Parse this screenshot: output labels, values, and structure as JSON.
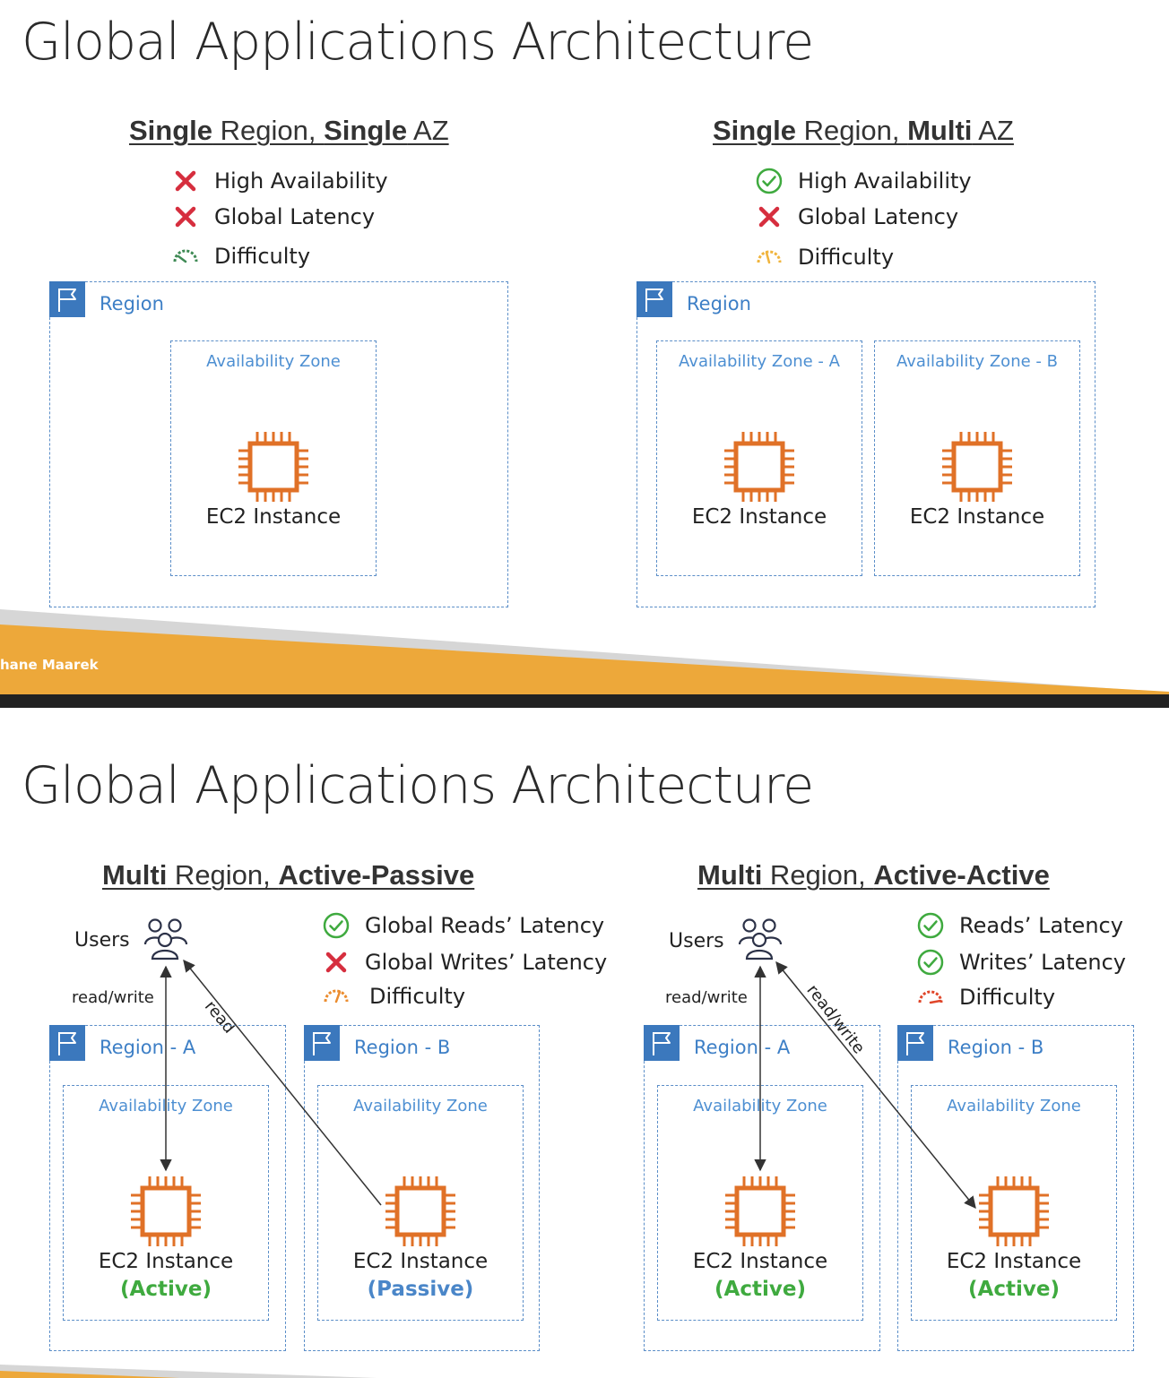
{
  "slide1": {
    "title": "Global Applications Architecture",
    "footer_author": "hane Maarek",
    "left": {
      "heading": {
        "b1": "Single",
        "t1": " Region, ",
        "b2": "Single",
        "t2": " AZ"
      },
      "criteria": [
        {
          "icon": "cross-icon",
          "label": "High Availability"
        },
        {
          "icon": "cross-icon",
          "label": "Global Latency"
        },
        {
          "icon": "difficulty-gauge-low-icon",
          "label": "Difficulty"
        }
      ],
      "region_label": "Region",
      "zones": [
        {
          "label": "Availability Zone",
          "instance": "EC2 Instance"
        }
      ]
    },
    "right": {
      "heading": {
        "b1": "Single",
        "t1": " Region, ",
        "b2": "Multi",
        "t2": " AZ"
      },
      "criteria": [
        {
          "icon": "check-circle-icon",
          "label": "High Availability"
        },
        {
          "icon": "cross-icon",
          "label": "Global Latency"
        },
        {
          "icon": "difficulty-gauge-medium-icon",
          "label": "Difficulty"
        }
      ],
      "region_label": "Region",
      "zones": [
        {
          "label": "Availability Zone - A",
          "instance": "EC2 Instance"
        },
        {
          "label": "Availability Zone - B",
          "instance": "EC2 Instance"
        }
      ]
    }
  },
  "slide2": {
    "title": "Global Applications Architecture",
    "left": {
      "heading": {
        "b1": "Multi",
        "t1": " Region, ",
        "b2": "Active-Passive"
      },
      "users_label": "Users",
      "rw_label": "read/write",
      "diag_label": "read",
      "criteria": [
        {
          "icon": "check-circle-icon",
          "label": "Global Reads’ Latency"
        },
        {
          "icon": "cross-icon",
          "label": "Global Writes’ Latency"
        },
        {
          "icon": "difficulty-gauge-high-icon",
          "label": "Difficulty"
        }
      ],
      "regions": [
        {
          "label": "Region - A",
          "zone": "Availability Zone",
          "instance": "EC2 Instance",
          "state": "(Active)"
        },
        {
          "label": "Region - B",
          "zone": "Availability Zone",
          "instance": "EC2 Instance",
          "state": "(Passive)"
        }
      ]
    },
    "right": {
      "heading": {
        "b1": "Multi",
        "t1": " Region, ",
        "b2": "Active-Active"
      },
      "users_label": "Users",
      "rw_label": "read/write",
      "diag_label": "read/write",
      "criteria": [
        {
          "icon": "check-circle-icon",
          "label": "Reads’ Latency"
        },
        {
          "icon": "check-circle-icon",
          "label": "Writes’ Latency"
        },
        {
          "icon": "difficulty-gauge-max-icon",
          "label": "Difficulty"
        }
      ],
      "regions": [
        {
          "label": "Region - A",
          "zone": "Availability Zone",
          "instance": "EC2 Instance",
          "state": "(Active)"
        },
        {
          "label": "Region - B",
          "zone": "Availability Zone",
          "instance": "EC2 Instance",
          "state": "(Active)"
        }
      ]
    }
  },
  "colors": {
    "ec2": "#e07127",
    "region_flag": "#3b78bd",
    "dashed_border": "#5b8ec8",
    "check": "#3faa3f",
    "cross": "#d62e3e",
    "footer_orange": "#eda83a"
  }
}
